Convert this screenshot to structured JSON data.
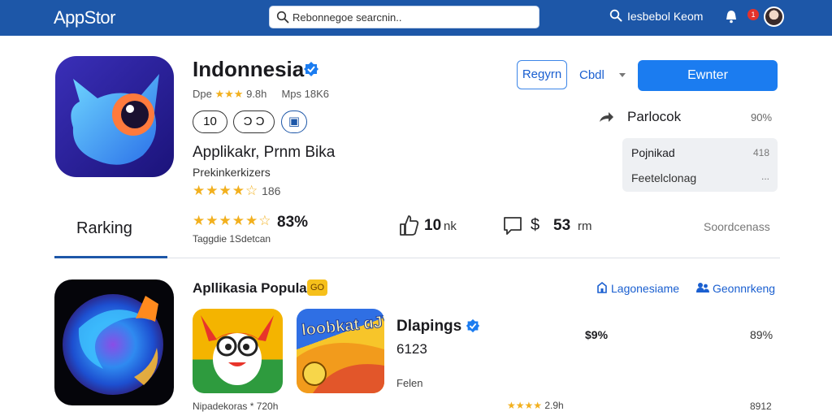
{
  "colors": {
    "header_bg": "#1d57a8",
    "primary": "#1b7cf0",
    "link": "#1a5fd0",
    "star": "#f2b01e",
    "badge": "#f6c01b"
  },
  "topbar": {
    "brand": "AppStor",
    "search_value": "Rebonnegoe searcnin..",
    "account_label": "Iesbebol Keom",
    "notification_count": "1"
  },
  "app": {
    "title": "Indonnesia",
    "developer": "Dpe",
    "dev_stars": "★★★",
    "dev_rating": "9.8h",
    "dev_meta": "Mps 18K6",
    "pills": [
      "10",
      "Ɔ Ͻ",
      "▣"
    ],
    "subtitle": "Applikakr, Prnm  Bika",
    "publisher": "Prekinkerkizers",
    "stars": "★★★★☆",
    "rating_count": "186"
  },
  "actions": {
    "outline_button": "Regyrn",
    "select_value": "Cbdl",
    "primary_button": "Ewnter",
    "share_label": "Parlocok",
    "share_value": "90%",
    "info": {
      "label_a": "Pojnikad",
      "value_a": "418",
      "label_b": "Feetelclonag",
      "more": "..."
    }
  },
  "stats": {
    "tab": "Rarking",
    "stars": "★★★★★☆",
    "percent": "83%",
    "caption": "Taggdie 1Sdetcan",
    "likes_value": "10",
    "likes_unit": "nk",
    "price_value": "53",
    "price_unit": "rm",
    "right_label": "Soordcenass"
  },
  "popular": {
    "title": "Apllikasia Popula",
    "badge": "GO",
    "link_1": "Lagonesiame",
    "link_2": "Geonnrkeng",
    "card_2_word": "loobkat  ɑJV",
    "app3": {
      "name": "Dlapings",
      "count": "6123",
      "tag": "Felen",
      "percent": "$9%"
    },
    "right_col_1": "89%",
    "bottom_caption": "Nipadekoras * 720h",
    "bottom_stars": "★★★★",
    "bottom_rating": "2.9h",
    "right_col_2": "8912"
  }
}
